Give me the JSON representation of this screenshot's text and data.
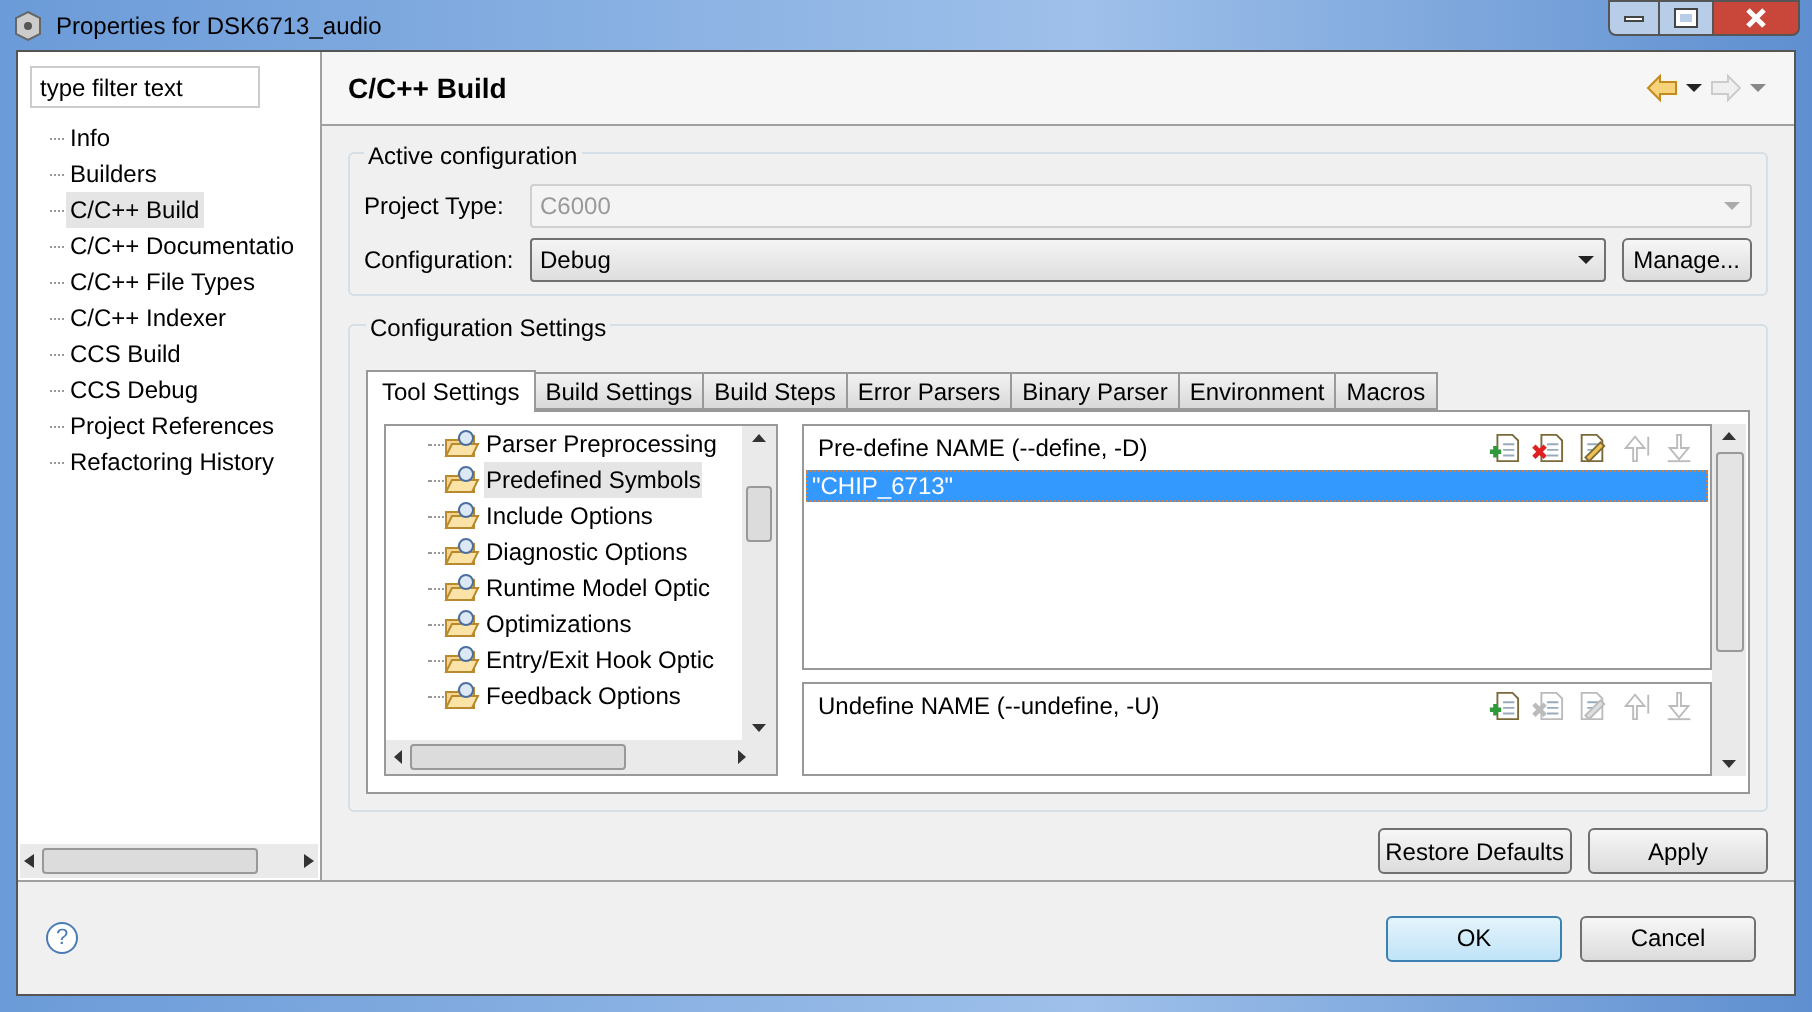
{
  "window": {
    "title": "Properties for DSK6713_audio"
  },
  "sidebar": {
    "filter": {
      "placeholder": "type filter text"
    },
    "items": [
      {
        "label": "Info",
        "selected": false
      },
      {
        "label": "Builders",
        "selected": false
      },
      {
        "label": "C/C++ Build",
        "selected": true
      },
      {
        "label": "C/C++ Documentatio",
        "selected": false
      },
      {
        "label": "C/C++ File Types",
        "selected": false
      },
      {
        "label": "C/C++ Indexer",
        "selected": false
      },
      {
        "label": "CCS Build",
        "selected": false
      },
      {
        "label": "CCS Debug",
        "selected": false
      },
      {
        "label": "Project References",
        "selected": false
      },
      {
        "label": "Refactoring History",
        "selected": false
      }
    ]
  },
  "page": {
    "title": "C/C++ Build",
    "active_configuration": {
      "title": "Active configuration",
      "project_type": {
        "label": "Project Type:",
        "value": "C6000",
        "disabled": true
      },
      "configuration": {
        "label": "Configuration:",
        "value": "Debug",
        "disabled": false
      },
      "manage_button": "Manage..."
    },
    "configuration_settings": {
      "title": "Configuration Settings",
      "tabs": [
        {
          "label": "Tool Settings",
          "selected": true
        },
        {
          "label": "Build Settings",
          "selected": false
        },
        {
          "label": "Build Steps",
          "selected": false
        },
        {
          "label": "Error Parsers",
          "selected": false
        },
        {
          "label": "Binary Parser",
          "selected": false
        },
        {
          "label": "Environment",
          "selected": false
        },
        {
          "label": "Macros",
          "selected": false
        }
      ],
      "tool_tree": [
        {
          "label": "Parser Preprocessing",
          "selected": false
        },
        {
          "label": "Predefined Symbols",
          "selected": true
        },
        {
          "label": "Include Options",
          "selected": false
        },
        {
          "label": "Diagnostic Options",
          "selected": false
        },
        {
          "label": "Runtime Model Optic",
          "selected": false
        },
        {
          "label": "Optimizations",
          "selected": false
        },
        {
          "label": "Entry/Exit Hook Optic",
          "selected": false
        },
        {
          "label": "Feedback Options",
          "selected": false
        }
      ],
      "lists": [
        {
          "title": "Pre-define NAME (--define, -D)",
          "tools": [
            {
              "kind": "add",
              "disabled": false
            },
            {
              "kind": "delete",
              "disabled": false
            },
            {
              "kind": "edit",
              "disabled": false
            },
            {
              "kind": "up",
              "disabled": true
            },
            {
              "kind": "down",
              "disabled": true
            }
          ],
          "items": [
            {
              "label": "\"CHIP_6713\"",
              "selected": true
            }
          ]
        },
        {
          "title": "Undefine NAME (--undefine, -U)",
          "tools": [
            {
              "kind": "add",
              "disabled": false
            },
            {
              "kind": "delete",
              "disabled": true
            },
            {
              "kind": "edit",
              "disabled": true
            },
            {
              "kind": "up",
              "disabled": true
            },
            {
              "kind": "down",
              "disabled": true
            }
          ]
        }
      ]
    },
    "buttons": [
      "Restore Defaults",
      "Apply"
    ]
  },
  "footer": {
    "help": "?",
    "buttons": [
      {
        "label": "OK",
        "default": true
      },
      {
        "label": "Cancel",
        "default": false
      }
    ]
  }
}
